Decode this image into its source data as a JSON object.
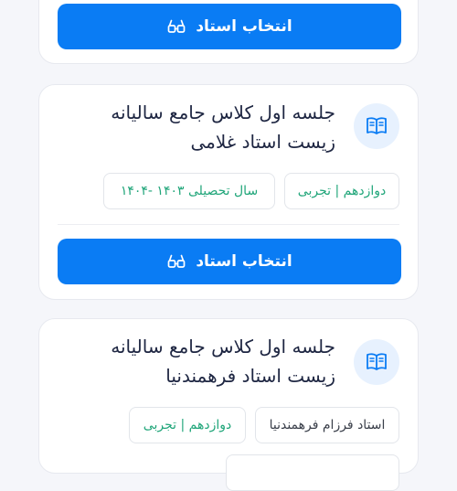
{
  "select_label": "انتخاب استاد",
  "cards": [
    {
      "title_line1": "",
      "title_line2": ""
    },
    {
      "title_line1": "جلسه اول کلاس جامع سالیانه",
      "title_line2": "زیست استاد غلامی",
      "chips": [
        "دوازدهم | تجربی",
        "سال تحصیلی ۱۴۰۳ -۱۴۰۴"
      ]
    },
    {
      "title_line1": "جلسه اول کلاس جامع سالیانه",
      "title_line2": "زیست استاد فرهمندنیا",
      "chips": [
        "استاد فرزام فرهمندنیا",
        "دوازدهم | تجربی"
      ]
    }
  ],
  "icons": {
    "glasses": "glasses-icon",
    "book": "book-icon"
  },
  "colors": {
    "accent": "#0a7cf4",
    "chip_green": "#21a67a",
    "title": "#1e2642"
  }
}
